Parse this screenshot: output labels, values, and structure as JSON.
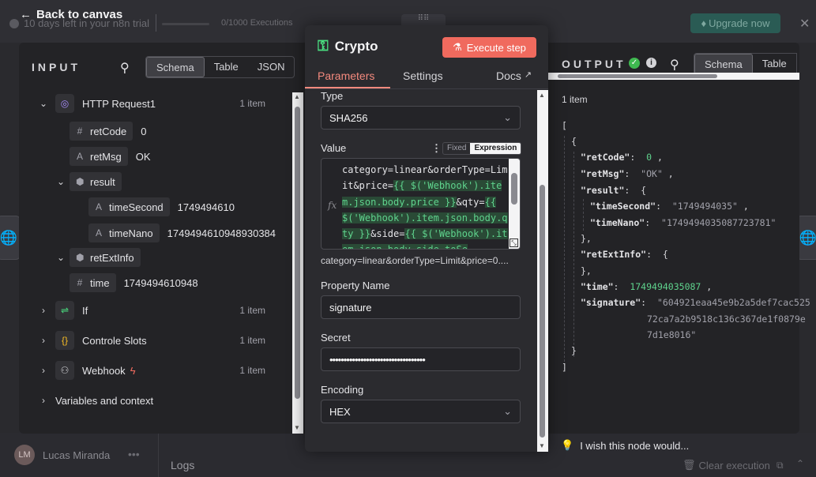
{
  "background": {
    "back_link": "Back to canvas",
    "trial_text": "10 days left in your n8n trial",
    "executions": "0/1000 Executions",
    "upgrade_label": "Upgrade now",
    "user_initials": "LM",
    "user_name": "Lucas Miranda",
    "logs_label": "Logs",
    "clear_execution": "Clear execution",
    "wish_text": "I wish this node would..."
  },
  "input": {
    "title": "INPUT",
    "tabs": [
      "Schema",
      "Table",
      "JSON"
    ],
    "active_tab": "Schema",
    "tree": {
      "http": {
        "label": "HTTP Request1",
        "count": "1 item"
      },
      "retCode": {
        "key": "retCode",
        "value": "0"
      },
      "retMsg": {
        "key": "retMsg",
        "value": "OK"
      },
      "result": {
        "key": "result"
      },
      "timeSecond": {
        "key": "timeSecond",
        "value": "1749494610"
      },
      "timeNano": {
        "key": "timeNano",
        "value": "1749494610948930384"
      },
      "retExtInfo": {
        "key": "retExtInfo"
      },
      "time": {
        "key": "time",
        "value": "1749494610948"
      },
      "if": {
        "label": "If",
        "count": "1 item"
      },
      "controle": {
        "label": "Controle Slots",
        "count": "1 item"
      },
      "webhook": {
        "label": "Webhook",
        "count": "1 item"
      },
      "variables": {
        "label": "Variables and context"
      }
    }
  },
  "node": {
    "title": "Crypto",
    "execute_label": "Execute step",
    "tabs": {
      "parameters": "Parameters",
      "settings": "Settings",
      "docs": "Docs"
    },
    "type_label": "Type",
    "type_value": "SHA256",
    "value_label": "Value",
    "fixed_label": "Fixed",
    "expression_label": "Expression",
    "expr_parts": [
      "category=linear&orderType=Limit&price=",
      "{{ $('Webhook').item.json.body.price }}",
      "&qty=",
      "{{ $('Webhook').item.json.body.qty }}",
      "&side=",
      "{{ $('Webhook').item.json.body.side.toSe"
    ],
    "expr_result": "category=linear&orderType=Limit&price=0....",
    "property_label": "Property Name",
    "property_value": "signature",
    "secret_label": "Secret",
    "secret_value": "••••••••••••••••••••••••••••••••••",
    "encoding_label": "Encoding",
    "encoding_value": "HEX"
  },
  "output": {
    "title": "OUTPUT",
    "tabs": [
      "Schema",
      "Table"
    ],
    "item_count": "1 item",
    "json": {
      "retCode": "0",
      "retMsg": "\"OK\"",
      "timeSecond": "\"1749494035\"",
      "timeNano": "\"1749494035087723781\"",
      "time": "1749494035087",
      "signature_1": "\"604921eaa45e9b2a5def7cac525",
      "signature_2": "72ca7a2b9518c136c367de1f0879e",
      "signature_3": "7d1e8016\""
    }
  },
  "colors": {
    "accent": "#f06a5e",
    "success": "#3fb950",
    "expression_green": "#5fd38d"
  }
}
